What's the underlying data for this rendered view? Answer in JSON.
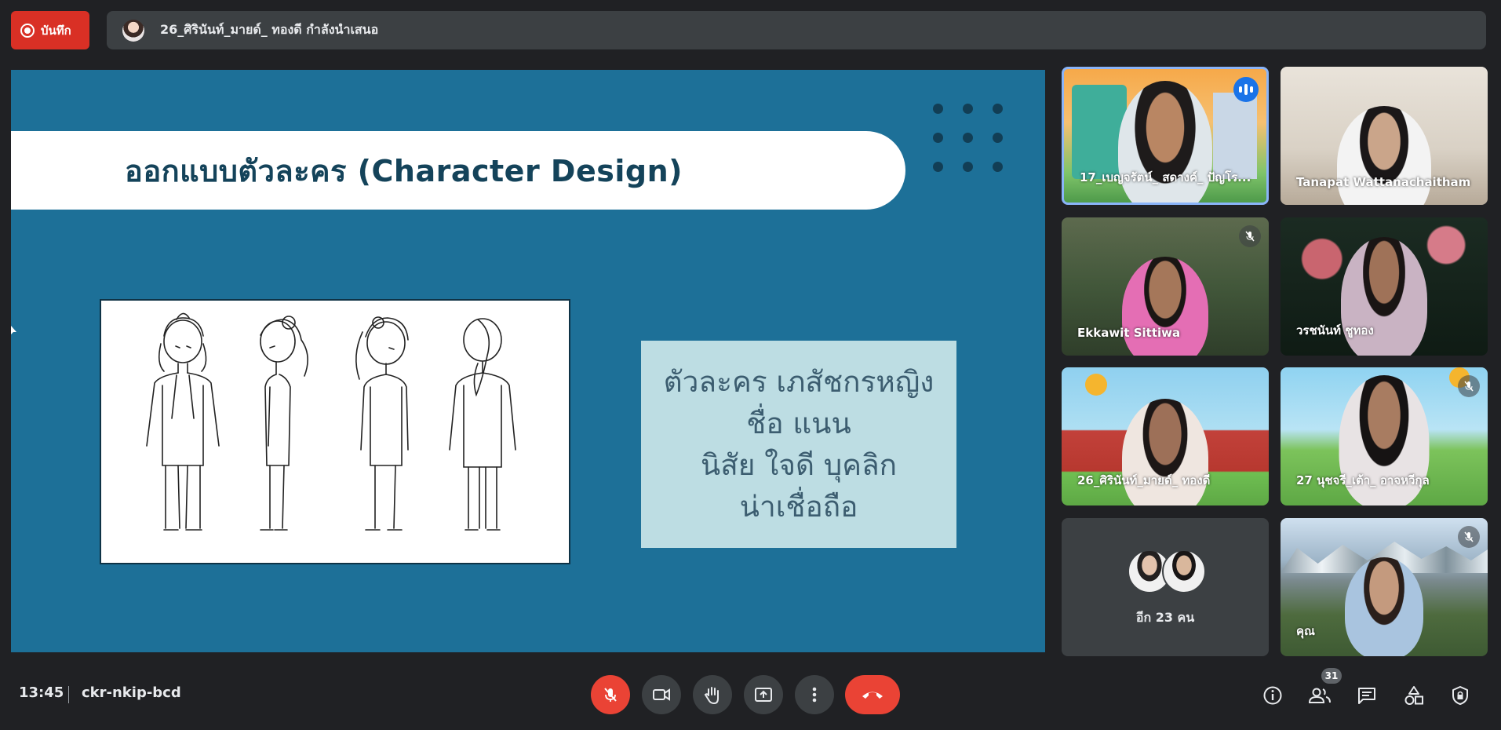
{
  "top_bar": {
    "record_label": "บันทึก",
    "presenting_text": "26_ศิรินันท์_มายด์_ ทองดี กำลังนำเสนอ"
  },
  "slide": {
    "title": "ออกแบบตัวละคร (Character Design)",
    "info_lines": [
      "ตัวละคร เภสัชกรหญิง",
      "ชื่อ แนน",
      "นิสัย ใจดี บุคลิก",
      "น่าเชื่อถือ"
    ]
  },
  "participants": [
    {
      "name": "17_เบญจรัตน์_ สดางค์_ ปัญโร...",
      "speaking": true
    },
    {
      "name": "Tanapat Wattanachaitham",
      "muted": false
    },
    {
      "name": "Ekkawit Sittiwa",
      "muted": true
    },
    {
      "name": "วรชนันท์ ชูทอง",
      "muted": false
    },
    {
      "name": "26_ศิรินันท์_มายด์_ ทองดี",
      "muted": false
    },
    {
      "name": "27 นุชจรี_เต้า_ อาจหวีกุล",
      "muted": true
    },
    {
      "name": "คุณ",
      "muted": true
    }
  ],
  "others_tile": {
    "label": "อีก 23 คน"
  },
  "bottom_bar": {
    "time": "13:45",
    "meeting_code": "ckr-nkip-bcd",
    "people_count": "31"
  },
  "icons": [
    "record-icon",
    "mic-off-icon",
    "camera-icon",
    "raise-hand-icon",
    "present-screen-icon",
    "more-options-icon",
    "end-call-icon",
    "info-icon",
    "people-icon",
    "chat-icon",
    "activities-icon",
    "host-controls-icon"
  ],
  "colors": {
    "record_red": "#d93025",
    "slide_bg": "#1d7098",
    "title_text": "#14435a",
    "info_box": "#bddde3",
    "speaking_blue": "#1a73e8",
    "control_bg": "#3c4043"
  }
}
